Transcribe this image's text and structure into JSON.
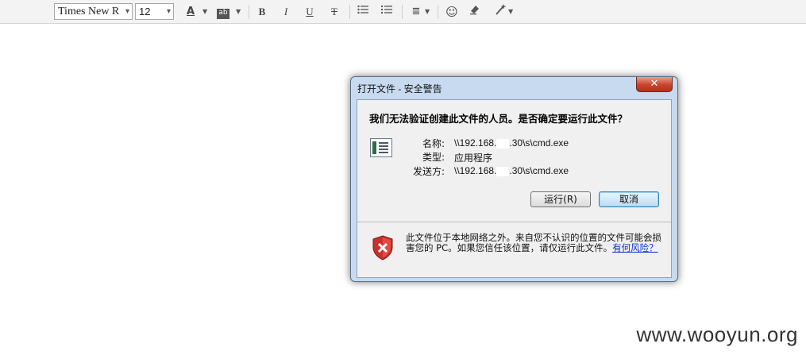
{
  "toolbar": {
    "font_family": "Times New R",
    "font_size": "12",
    "font_color_glyph": "A",
    "highlight_glyph": "ab",
    "bold_glyph": "B",
    "italic_glyph": "I",
    "underline_glyph": "U",
    "strike_glyph": "T",
    "emoji_glyph": "☺",
    "align_glyph": "≣"
  },
  "dialog": {
    "title": "打开文件 - 安全警告",
    "close_glyph": "✕",
    "question": "我们无法验证创建此文件的人员。是否确定要运行此文件？",
    "fields": [
      {
        "label": "名称:",
        "value_prefix": "\\\\192.168.",
        "value_suffix": ".30\\s\\cmd.exe"
      },
      {
        "label": "类型:",
        "value": "应用程序"
      },
      {
        "label": "发送方:",
        "value_prefix": "\\\\192.168.",
        "value_suffix": ".30\\s\\cmd.exe"
      }
    ],
    "run_button": "运行(R)",
    "cancel_button": "取消",
    "warning_text": "此文件位于本地网络之外。来自您不认识的位置的文件可能会损害您的 PC。如果您信任该位置，请仅运行此文件。",
    "warning_link": "有何风险？"
  },
  "watermark": "www.wooyun.org",
  "colors": {
    "dialog_frame": "#c8daf0",
    "close_button": "#c8432b",
    "link": "#0033cc"
  }
}
